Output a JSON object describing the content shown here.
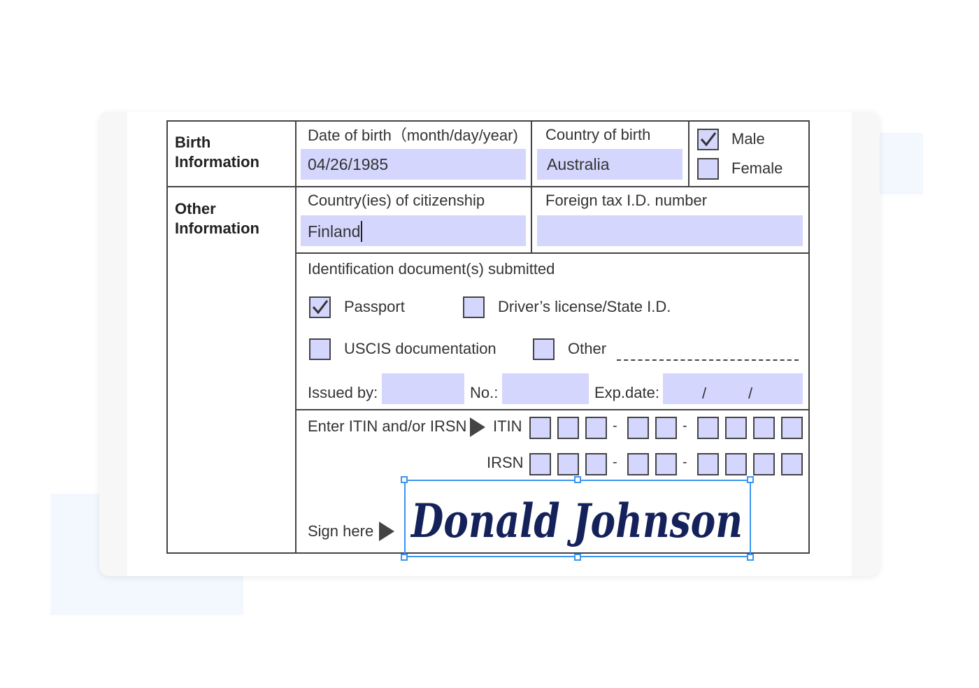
{
  "birth": {
    "section": "Birth Information",
    "dob_label": "Date of birth（month/day/year)",
    "dob_value": "04/26/1985",
    "country_label": "Country of birth",
    "country_value": "Australia",
    "male_label": "Male",
    "male_checked": true,
    "female_label": "Female",
    "female_checked": false
  },
  "other": {
    "section": "Other Information",
    "citizenship_label": "Country(ies) of citizenship",
    "citizenship_value": "Finland",
    "tax_label": "Foreign tax I.D. number",
    "tax_value": ""
  },
  "idDocs": {
    "label": "Identification document(s) submitted",
    "passport": "Passport",
    "passport_checked": true,
    "license": "Driver’s license/State I.D.",
    "uscis": "USCIS documentation",
    "other": "Other",
    "issued_label": "Issued by:",
    "no_label": "No.:",
    "exp_label": "Exp.date:",
    "exp_sep": "/"
  },
  "itin": {
    "enter_label": "Enter ITIN and/or IRSN",
    "itin_label": "ITIN",
    "irsn_label": "IRSN",
    "dash": "-"
  },
  "sign": {
    "label": "Sign here",
    "signature": "Donald Johnson"
  },
  "colors": {
    "field": "#d4d6fd",
    "ink": "#14215a",
    "selection": "#3b95f0"
  }
}
